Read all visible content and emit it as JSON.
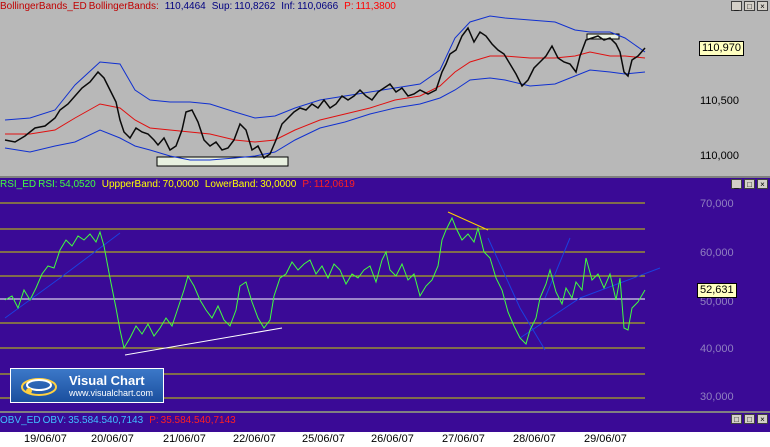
{
  "price_pane": {
    "indicator_name": "BollingerBands_ED",
    "indicator_label": "BollingerBands:",
    "value": "110,4464",
    "sup_label": "Sup:",
    "sup_value": "110,8262",
    "inf_label": "Inf:",
    "inf_value": "110,0666",
    "p_label": "P:",
    "p_value": "111,3800",
    "current_price": "110,970",
    "axis_ticks": [
      "110,500",
      "110,000"
    ]
  },
  "rsi_pane": {
    "indicator_name": "RSI_ED",
    "rsi_label": "RSI:",
    "rsi_value": "54,0520",
    "upper_label": "UppperBand:",
    "upper_value": "70,0000",
    "lower_label": "LowerBand:",
    "lower_value": "30,0000",
    "p_label": "P:",
    "p_value": "112,0619",
    "current_value": "52,631",
    "axis_ticks": [
      "70,000",
      "60,000",
      "50,000",
      "40,000",
      "30,000"
    ]
  },
  "obv_pane": {
    "indicator_name": "OBV_ED",
    "obv_label": "OBV:",
    "obv_value": "35.584.540,7143",
    "p_label": "P:",
    "p_value": "35.584.540,7143"
  },
  "dates": [
    "19/06/07",
    "20/06/07",
    "21/06/07",
    "22/06/07",
    "25/06/07",
    "26/06/07",
    "27/06/07",
    "28/06/07",
    "29/06/07"
  ],
  "logo": {
    "title": "Visual Chart",
    "url": "www.visualchart.com"
  },
  "window_buttons": {
    "minimize": "_",
    "maximize": "□",
    "close": "×"
  },
  "colors": {
    "price_bg": "#b8b8b8",
    "rsi_bg": "#3a0a96",
    "bollinger_band": "#1030d0",
    "bollinger_mid": "#e01010",
    "rsi_line": "#40ff40"
  }
}
